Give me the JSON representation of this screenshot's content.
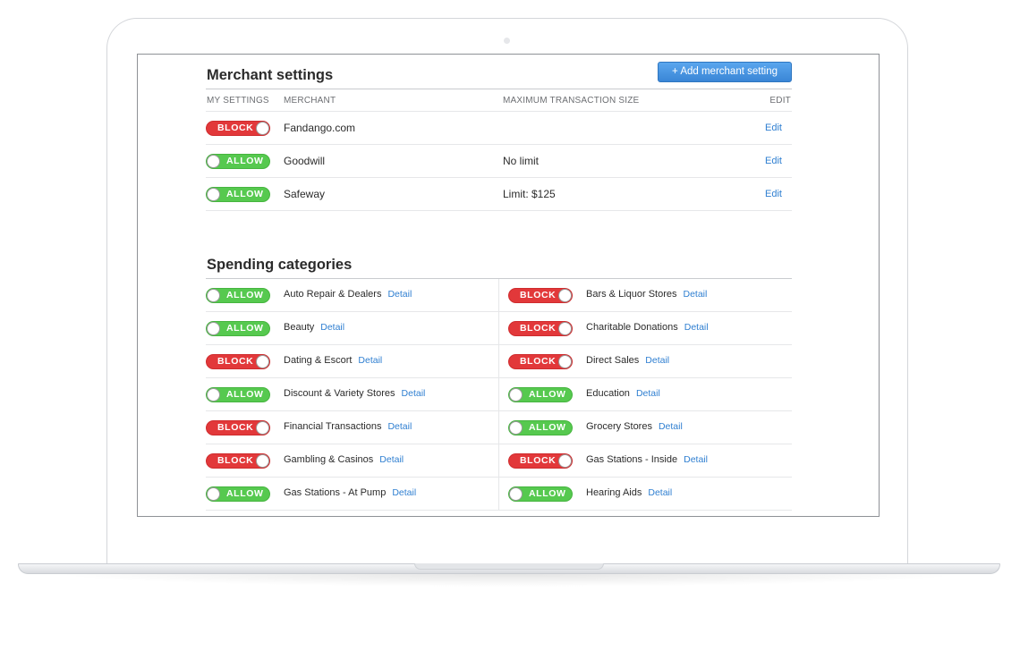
{
  "merchant_settings": {
    "title": "Merchant settings",
    "add_button": "+ Add merchant setting",
    "columns": {
      "my_settings": "MY SETTINGS",
      "merchant": "MERCHANT",
      "max_size": "MAXIMUM TRANSACTION SIZE",
      "edit": "EDIT"
    },
    "rows": [
      {
        "status": "BLOCK",
        "merchant": "Fandango.com",
        "limit": "",
        "edit": "Edit"
      },
      {
        "status": "ALLOW",
        "merchant": "Goodwill",
        "limit": "No limit",
        "edit": "Edit"
      },
      {
        "status": "ALLOW",
        "merchant": "Safeway",
        "limit": "Limit: $125",
        "edit": "Edit"
      }
    ]
  },
  "spending_categories": {
    "title": "Spending categories",
    "detail_label": "Detail",
    "items": [
      {
        "status": "ALLOW",
        "name": "Auto Repair & Dealers",
        "detail": "Detail"
      },
      {
        "status": "BLOCK",
        "name": "Bars & Liquor Stores",
        "detail": "Detail"
      },
      {
        "status": "ALLOW",
        "name": "Beauty",
        "detail": "Detail"
      },
      {
        "status": "BLOCK",
        "name": "Charitable Donations",
        "detail": "Detail"
      },
      {
        "status": "BLOCK",
        "name": "Dating & Escort",
        "detail": "Detail"
      },
      {
        "status": "BLOCK",
        "name": "Direct Sales",
        "detail": "Detail"
      },
      {
        "status": "ALLOW",
        "name": "Discount & Variety Stores",
        "detail": "Detail"
      },
      {
        "status": "ALLOW",
        "name": "Education",
        "detail": "Detail"
      },
      {
        "status": "BLOCK",
        "name": "Financial Transactions",
        "detail": "Detail"
      },
      {
        "status": "ALLOW",
        "name": "Grocery Stores",
        "detail": "Detail"
      },
      {
        "status": "BLOCK",
        "name": "Gambling & Casinos",
        "detail": "Detail"
      },
      {
        "status": "BLOCK",
        "name": "Gas Stations - Inside",
        "detail": "Detail"
      },
      {
        "status": "ALLOW",
        "name": "Gas Stations - At Pump",
        "detail": "Detail"
      },
      {
        "status": "ALLOW",
        "name": "Hearing Aids",
        "detail": "Detail"
      }
    ]
  },
  "colors": {
    "block": "#e2383a",
    "allow": "#56c94f",
    "link": "#2f7fd1",
    "primary_button": "#3a86d6"
  }
}
